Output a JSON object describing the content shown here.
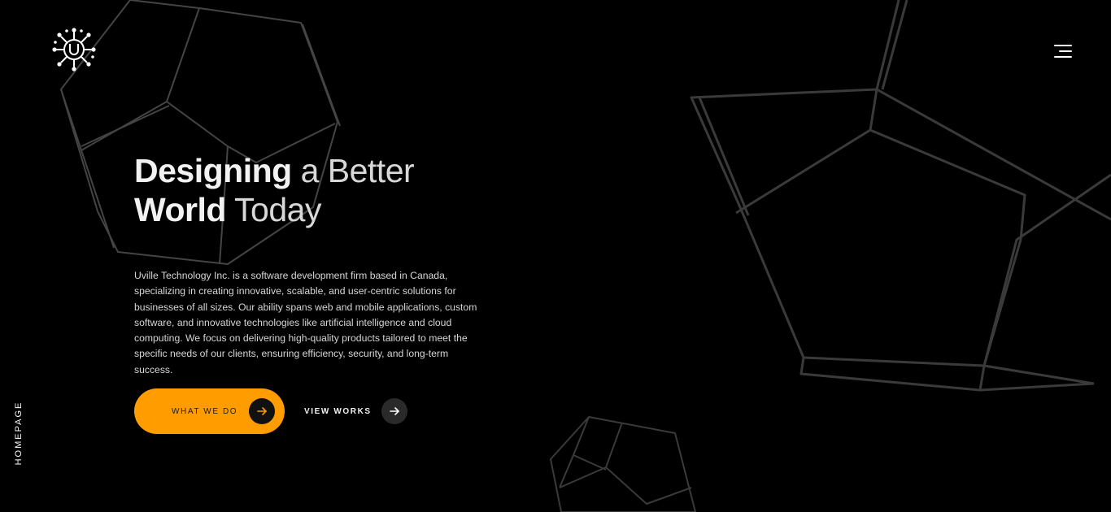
{
  "nav": {
    "logo_icon": "circuit-u-logo",
    "menu_icon": "hamburger-menu-icon"
  },
  "side": {
    "label": "HOMEPAGE"
  },
  "hero": {
    "title_line1_bold": "Designing",
    "title_line1_light": " a Better",
    "title_line2_bold": "World",
    "title_line2_light": " Today",
    "description": "Uville Technology Inc. is a software development firm based in Canada, specializing in creating innovative, scalable, and user-centric solutions for businesses of all sizes. Our ability spans web and mobile applications, custom software, and innovative technologies like artificial intelligence and cloud computing. We focus on delivering high-quality products tailored to meet the specific needs of our clients, ensuring efficiency, security, and long-term success."
  },
  "actions": {
    "primary_label": "WHAT WE DO",
    "secondary_label": "VIEW WORKS",
    "arrow_icon": "arrow-right-icon"
  },
  "colors": {
    "accent": "#ff9d00",
    "background": "#000000",
    "wireframe": "#3a3a3a"
  }
}
